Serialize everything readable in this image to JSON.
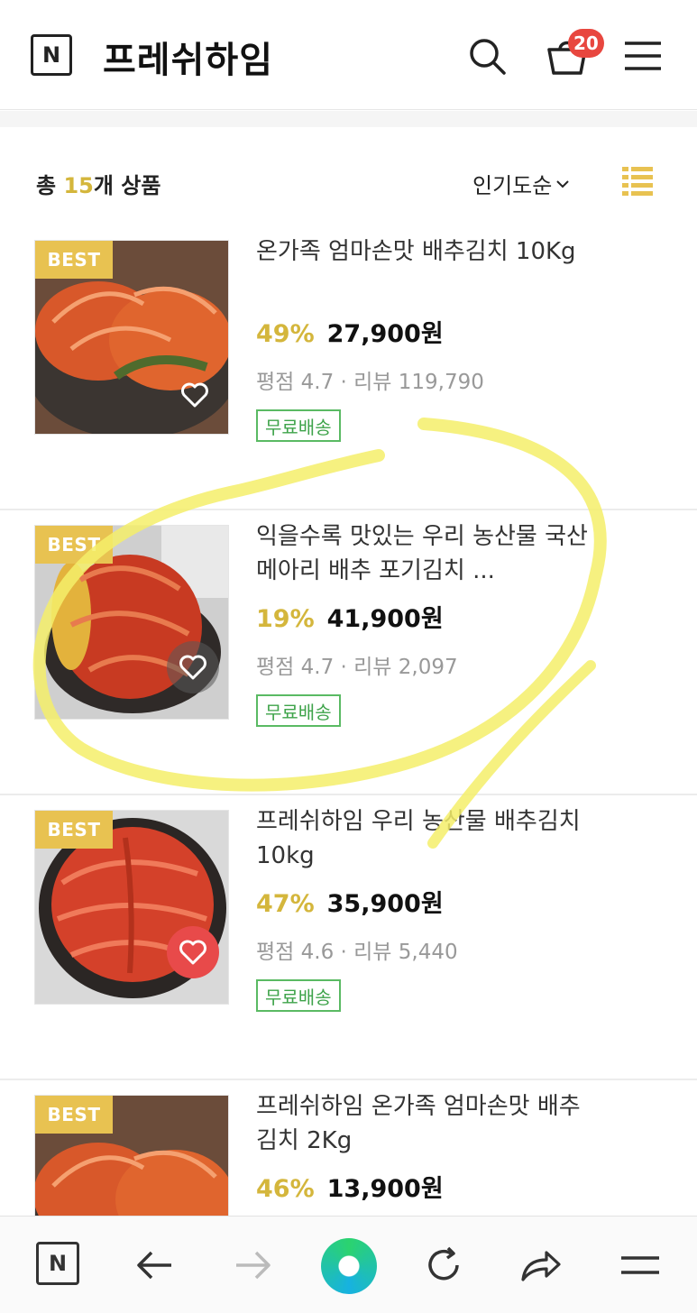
{
  "header": {
    "logo_letter": "N",
    "store_name": "프레쉬하임",
    "cart_count": "20",
    "icons": [
      "search-icon",
      "cart-icon",
      "menu-icon"
    ]
  },
  "list_header": {
    "total_prefix": "총 ",
    "total_num": "15",
    "total_suffix": "개 상품",
    "sort_label": "인기도순",
    "view_icon": "list-view-icon"
  },
  "products": [
    {
      "badge": "BEST",
      "title": "온가족 엄마손맛 배추김치 10Kg",
      "discount": "49%",
      "price": "27,900원",
      "meta": "평점 4.7 · 리뷰 119,790",
      "shipping": "무료배송",
      "liked": false
    },
    {
      "badge": "BEST",
      "title": "익을수록 맛있는 우리 농산물 국산 메아리 배추 포기김치 ...",
      "discount": "19%",
      "price": "41,900원",
      "meta": "평점 4.7 · 리뷰 2,097",
      "shipping": "무료배송",
      "liked": false
    },
    {
      "badge": "BEST",
      "title": "프레쉬하임 우리 농산물 배추김치 10kg",
      "discount": "47%",
      "price": "35,900원",
      "meta": "평점 4.6 · 리뷰 5,440",
      "shipping": "무료배송",
      "liked": true
    },
    {
      "badge": "BEST",
      "title": "프레쉬하임 온가족 엄마손맛 배추김치 2Kg",
      "discount": "46%",
      "price": "13,900원",
      "liked": false
    }
  ],
  "colors": {
    "accent_yellow": "#d4b63c",
    "badge_yellow": "#e8c251",
    "like_red": "#e84a4a",
    "ship_green": "#3ea34a",
    "annotation_yellow": "#f4ef6a"
  },
  "browser_bar": {
    "logo_letter": "N",
    "icons": [
      "n-home-icon",
      "back-arrow-icon",
      "forward-arrow-icon",
      "green-dot-home-icon",
      "refresh-icon",
      "share-icon",
      "menu-icon"
    ]
  }
}
